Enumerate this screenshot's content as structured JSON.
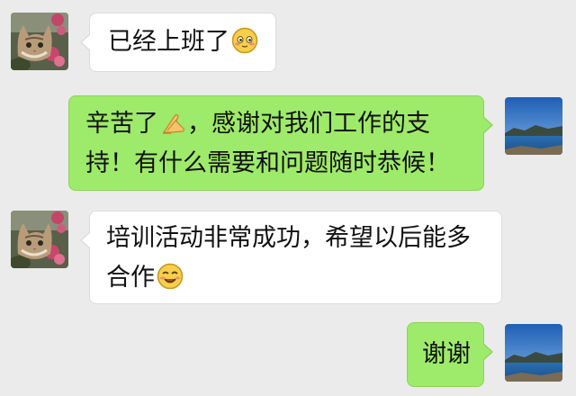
{
  "messages": [
    {
      "direction": "incoming",
      "sender_avatar": "cat-with-flowers-avatar",
      "text": "已经上班了",
      "trailing_icon": "shy-smile-emoji-icon"
    },
    {
      "direction": "outgoing",
      "sender_avatar": "lake-mountain-avatar",
      "line1_a": "辛苦了",
      "line1_icon": "praying-hands-emoji-icon",
      "line1_b": "，感谢对我们工作的支",
      "line2": "持！有什么需要和问题随时恭候！"
    },
    {
      "direction": "incoming",
      "sender_avatar": "cat-with-flowers-avatar",
      "line1": "培训活动非常成功，希望以后能多",
      "line2": "合作",
      "trailing_icon": "smile-emoji-icon"
    },
    {
      "direction": "outgoing",
      "sender_avatar": "lake-mountain-avatar",
      "text": "谢谢"
    }
  ],
  "colors": {
    "background": "#ebebeb",
    "incoming_bubble": "#ffffff",
    "outgoing_bubble": "#9eea6a",
    "text": "#111111"
  }
}
